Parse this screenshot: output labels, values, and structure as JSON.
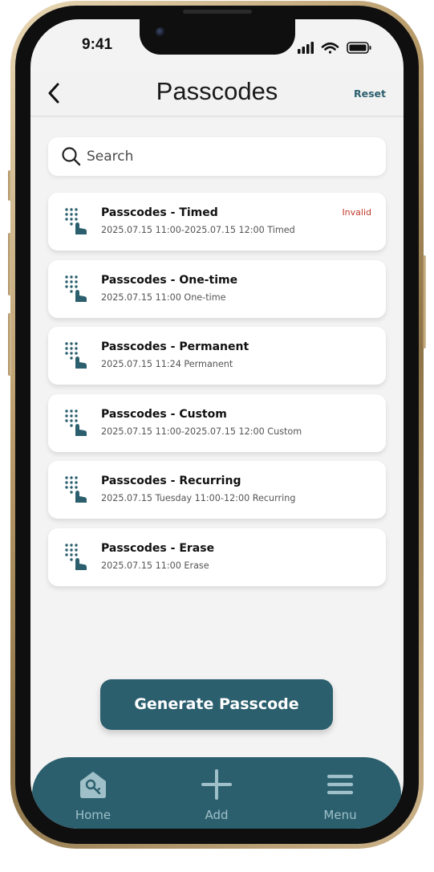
{
  "status_bar": {
    "time": "9:41"
  },
  "header": {
    "title": "Passcodes",
    "reset_label": "Reset",
    "back_icon": "chevron-left-icon"
  },
  "search": {
    "placeholder": "Search",
    "value": ""
  },
  "passcodes": [
    {
      "title": "Passcodes - Timed",
      "detail": "2025.07.15 11:00-2025.07.15 12:00 Timed",
      "status": "Invalid"
    },
    {
      "title": "Passcodes - One-time",
      "detail": "2025.07.15 11:00 One-time",
      "status": ""
    },
    {
      "title": "Passcodes - Permanent",
      "detail": "2025.07.15 11:24 Permanent",
      "status": ""
    },
    {
      "title": "Passcodes - Custom",
      "detail": "2025.07.15 11:00-2025.07.15 12:00 Custom",
      "status": ""
    },
    {
      "title": "Passcodes - Recurring",
      "detail": "2025.07.15 Tuesday 11:00-12:00 Recurring",
      "status": ""
    },
    {
      "title": "Passcodes - Erase",
      "detail": "2025.07.15 11:00 Erase",
      "status": ""
    }
  ],
  "generate_button": {
    "label": "Generate Passcode"
  },
  "bottom_nav": {
    "items": [
      {
        "label": "Home",
        "icon": "home-key-icon"
      },
      {
        "label": "Add",
        "icon": "plus-icon"
      },
      {
        "label": "Menu",
        "icon": "hamburger-menu-icon"
      }
    ]
  },
  "colors": {
    "accent": "#2b5f6e",
    "invalid": "#c0392b",
    "screen_bg": "#f3f3f3",
    "nav_label": "#9fc0c8"
  }
}
